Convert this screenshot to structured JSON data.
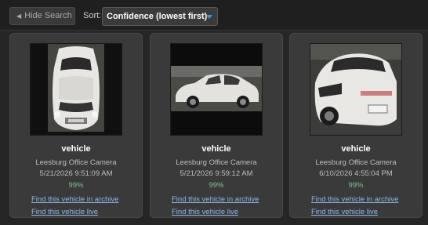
{
  "toolbar": {
    "hide_search_label": "Hide Search",
    "sort_label": "Sort:",
    "sort_value": "Confidence (lowest first)"
  },
  "results": [
    {
      "title": "vehicle",
      "camera": "Leesburg Office Camera",
      "timestamp": "5/21/2026 9:51:09 AM",
      "confidence": "99%",
      "link_archive": "Find this vehicle in archive",
      "link_live": "Find this vehicle live"
    },
    {
      "title": "vehicle",
      "camera": "Leesburg Office Camera",
      "timestamp": "5/21/2026 9:59:12 AM",
      "confidence": "99%",
      "link_archive": "Find this vehicle in archive",
      "link_live": "Find this vehicle live"
    },
    {
      "title": "vehicle",
      "camera": "Leesburg Office Camera",
      "timestamp": "6/10/2026 4:55:04 PM",
      "confidence": "99%",
      "link_archive": "Find this vehicle in archive",
      "link_live": "Find this vehicle live"
    }
  ],
  "colors": {
    "background": "#262626",
    "card": "#3a3a3a",
    "link": "#8cb8e8",
    "confidence": "#7fc08a",
    "accent": "#4a8fd6"
  }
}
